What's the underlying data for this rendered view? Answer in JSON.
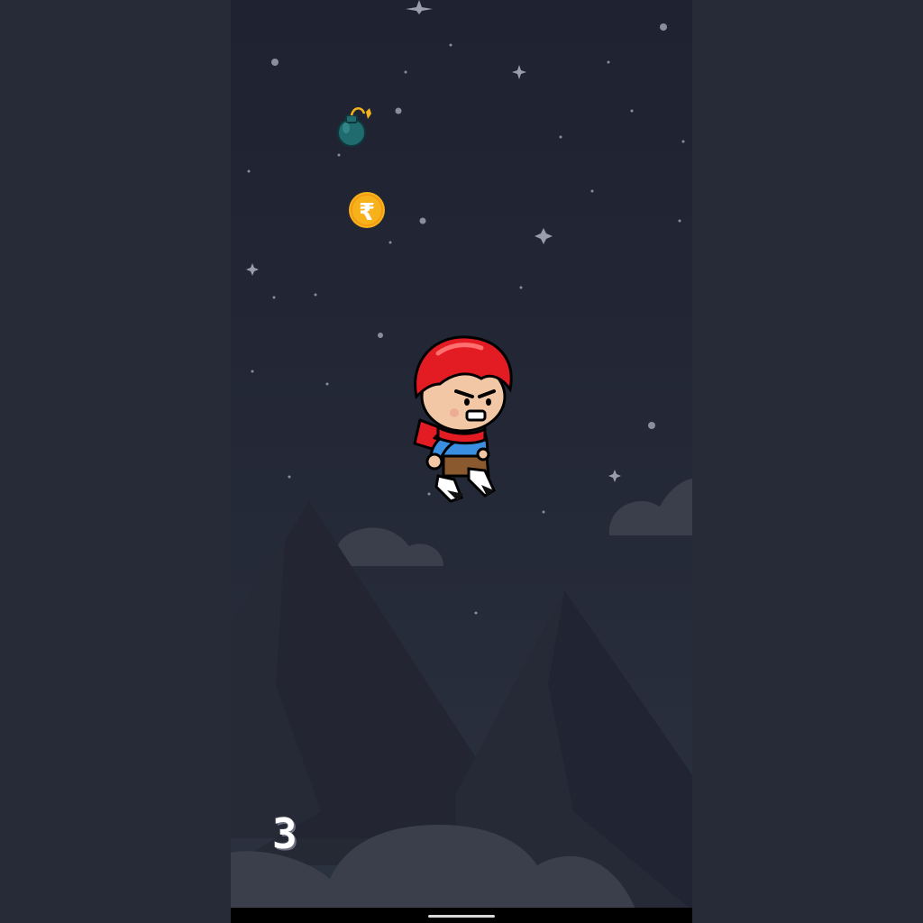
{
  "game": {
    "score": "3",
    "coin_symbol": "₹",
    "player": "red-haired-boy-jumping",
    "items": [
      "bomb",
      "rupee-coin"
    ]
  },
  "colors": {
    "page_background": "#272a37",
    "sky_top": "#1f2230",
    "sky_bottom": "#2b3240",
    "mountain": "#262a37",
    "cloud": "#3b3f4c",
    "coin": "#f7b21b",
    "bomb": "#1f6b6e",
    "player_hair": "#e31b23"
  }
}
